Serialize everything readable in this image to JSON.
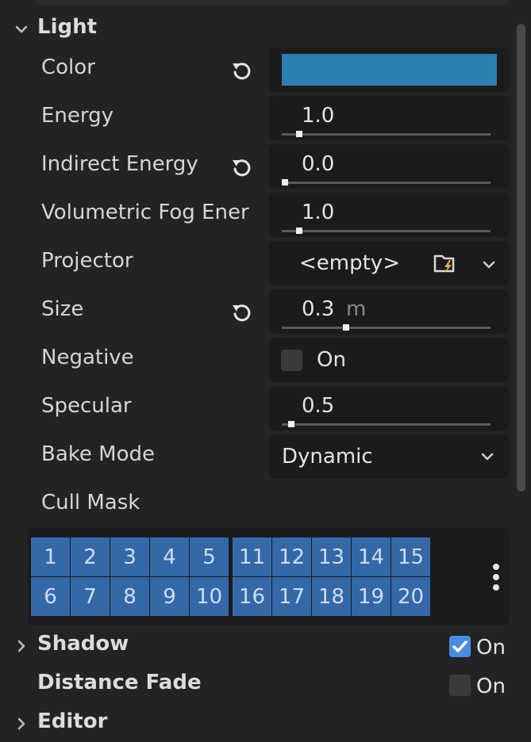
{
  "inspector": {
    "light": {
      "title": "Light",
      "color": {
        "label": "Color",
        "value_hex": "#2a7fb0"
      },
      "energy": {
        "label": "Energy",
        "value": "1.0",
        "fraction": 0.07
      },
      "indirect_energy": {
        "label": "Indirect Energy",
        "value": "0.0",
        "fraction": 0.0
      },
      "volumetric_fog_energy": {
        "label": "Volumetric Fog Ener",
        "value": "1.0",
        "fraction": 0.07
      },
      "projector": {
        "label": "Projector",
        "value": "<empty>"
      },
      "size": {
        "label": "Size",
        "value": "0.3",
        "unit": "m",
        "fraction": 0.3
      },
      "negative": {
        "label": "Negative",
        "checkbox_label": "On",
        "checked": false
      },
      "specular": {
        "label": "Specular",
        "value": "0.5",
        "fraction": 0.03
      },
      "bake_mode": {
        "label": "Bake Mode",
        "value": "Dynamic"
      },
      "cull_mask": {
        "label": "Cull Mask",
        "layers_row1": [
          "1",
          "2",
          "3",
          "4",
          "5",
          "11",
          "12",
          "13",
          "14",
          "15"
        ],
        "layers_row2": [
          "6",
          "7",
          "8",
          "9",
          "10",
          "16",
          "17",
          "18",
          "19",
          "20"
        ]
      }
    },
    "shadow": {
      "title": "Shadow",
      "checkbox_label": "On",
      "checked": true
    },
    "distance_fade": {
      "title": "Distance Fade",
      "checkbox_label": "On",
      "checked": false
    },
    "editor": {
      "title": "Editor"
    }
  },
  "colors": {
    "accent": "#4a8de0",
    "layer_cell": "#3568a8",
    "panel_bg": "#232323",
    "field_bg": "#1b1b1b"
  },
  "icons": {
    "reset": "revert-arrow-icon",
    "collapse": "chevron-down-icon",
    "expand": "chevron-right-icon",
    "load": "folder-load-icon",
    "menu": "vertical-dots-icon"
  }
}
